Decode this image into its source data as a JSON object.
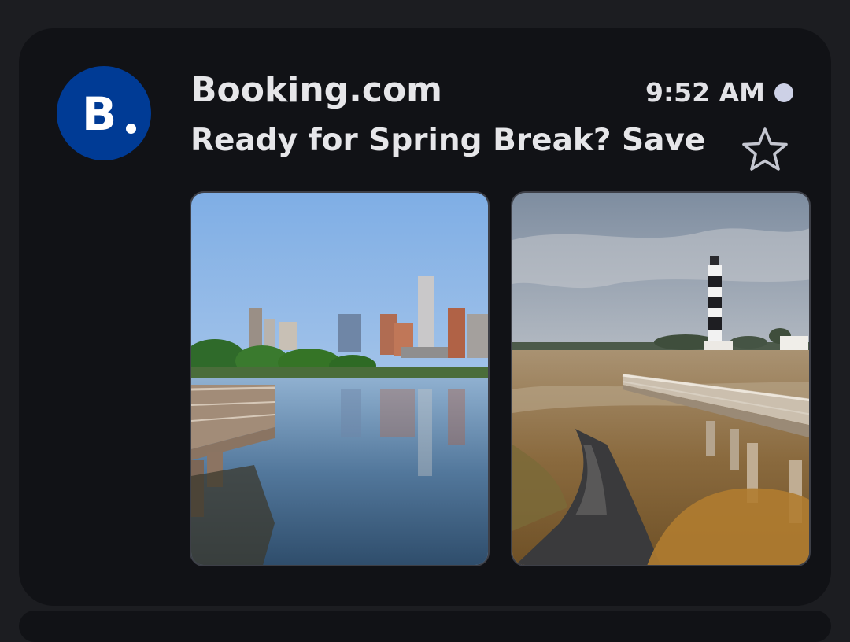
{
  "email": {
    "sender": "Booking.com",
    "avatar_letter": "B",
    "time": "9:52 AM",
    "subject": "Ready for Spring Break? Save ...",
    "unread": true,
    "starred": false
  },
  "attachments": [
    {
      "name": "city-skyline-boardwalk-photo"
    },
    {
      "name": "lighthouse-marsh-boardwalk-photo"
    }
  ],
  "colors": {
    "background": "#1c1d21",
    "card": "#111216",
    "avatar": "#003b95",
    "unread_dot": "#cdd1e6",
    "text": "#e6e6e9"
  }
}
